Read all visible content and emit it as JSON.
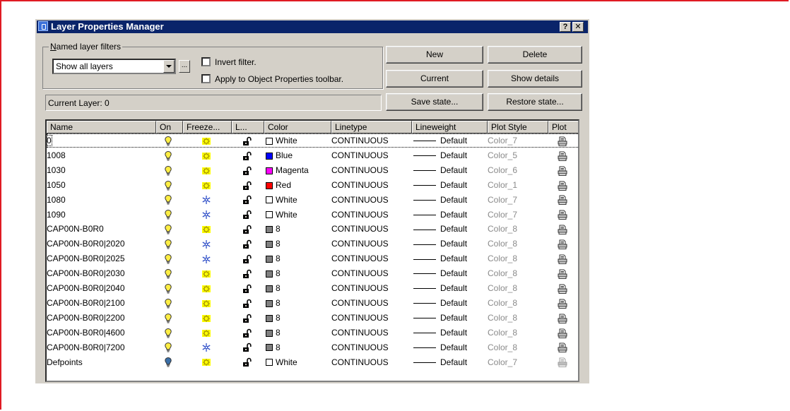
{
  "window": {
    "title": "Layer Properties Manager",
    "help_label": "?",
    "close_label": "✕"
  },
  "filters": {
    "group_label": "Named layer filters",
    "selected": "Show all layers",
    "ellipsis_label": "...",
    "invert_label": "Invert filter.",
    "invert_checked": false,
    "apply_label": "Apply to Object Properties toolbar.",
    "apply_checked": false
  },
  "buttons": {
    "new": "New",
    "delete": "Delete",
    "current": "Current",
    "show_details": "Show details",
    "save_state": "Save state...",
    "restore_state": "Restore state..."
  },
  "current_layer": "Current Layer:  0",
  "table": {
    "columns": [
      "Name",
      "On",
      "Freeze...",
      "L...",
      "Color",
      "Linetype",
      "Lineweight",
      "Plot Style",
      "Plot"
    ],
    "rows": [
      {
        "name": "0",
        "on": true,
        "freeze": "thawed",
        "locked": false,
        "color": "White",
        "color_hex": "#ffffff",
        "linetype": "CONTINUOUS",
        "lineweight": "Default",
        "plot_style": "Color_7",
        "plot": true
      },
      {
        "name": "1008",
        "on": true,
        "freeze": "thawed",
        "locked": false,
        "color": "Blue",
        "color_hex": "#0000ff",
        "linetype": "CONTINUOUS",
        "lineweight": "Default",
        "plot_style": "Color_5",
        "plot": true
      },
      {
        "name": "1030",
        "on": true,
        "freeze": "thawed",
        "locked": false,
        "color": "Magenta",
        "color_hex": "#ff00ff",
        "linetype": "CONTINUOUS",
        "lineweight": "Default",
        "plot_style": "Color_6",
        "plot": true
      },
      {
        "name": "1050",
        "on": true,
        "freeze": "thawed",
        "locked": false,
        "color": "Red",
        "color_hex": "#ff0000",
        "linetype": "CONTINUOUS",
        "lineweight": "Default",
        "plot_style": "Color_1",
        "plot": true
      },
      {
        "name": "1080",
        "on": true,
        "freeze": "frozen",
        "locked": false,
        "color": "White",
        "color_hex": "#ffffff",
        "linetype": "CONTINUOUS",
        "lineweight": "Default",
        "plot_style": "Color_7",
        "plot": true
      },
      {
        "name": "1090",
        "on": true,
        "freeze": "frozen",
        "locked": false,
        "color": "White",
        "color_hex": "#ffffff",
        "linetype": "CONTINUOUS",
        "lineweight": "Default",
        "plot_style": "Color_7",
        "plot": true
      },
      {
        "name": "CAP00N-B0R0",
        "on": true,
        "freeze": "thawed",
        "locked": false,
        "color": "8",
        "color_hex": "#808080",
        "linetype": "CONTINUOUS",
        "lineweight": "Default",
        "plot_style": "Color_8",
        "plot": true
      },
      {
        "name": "CAP00N-B0R0|2020",
        "on": true,
        "freeze": "frozen",
        "locked": false,
        "color": "8",
        "color_hex": "#808080",
        "linetype": "CONTINUOUS",
        "lineweight": "Default",
        "plot_style": "Color_8",
        "plot": true
      },
      {
        "name": "CAP00N-B0R0|2025",
        "on": true,
        "freeze": "frozen",
        "locked": false,
        "color": "8",
        "color_hex": "#808080",
        "linetype": "CONTINUOUS",
        "lineweight": "Default",
        "plot_style": "Color_8",
        "plot": true
      },
      {
        "name": "CAP00N-B0R0|2030",
        "on": true,
        "freeze": "thawed",
        "locked": false,
        "color": "8",
        "color_hex": "#808080",
        "linetype": "CONTINUOUS",
        "lineweight": "Default",
        "plot_style": "Color_8",
        "plot": true
      },
      {
        "name": "CAP00N-B0R0|2040",
        "on": true,
        "freeze": "thawed",
        "locked": false,
        "color": "8",
        "color_hex": "#808080",
        "linetype": "CONTINUOUS",
        "lineweight": "Default",
        "plot_style": "Color_8",
        "plot": true
      },
      {
        "name": "CAP00N-B0R0|2100",
        "on": true,
        "freeze": "thawed",
        "locked": false,
        "color": "8",
        "color_hex": "#808080",
        "linetype": "CONTINUOUS",
        "lineweight": "Default",
        "plot_style": "Color_8",
        "plot": true
      },
      {
        "name": "CAP00N-B0R0|2200",
        "on": true,
        "freeze": "thawed",
        "locked": false,
        "color": "8",
        "color_hex": "#808080",
        "linetype": "CONTINUOUS",
        "lineweight": "Default",
        "plot_style": "Color_8",
        "plot": true
      },
      {
        "name": "CAP00N-B0R0|4600",
        "on": true,
        "freeze": "thawed",
        "locked": false,
        "color": "8",
        "color_hex": "#808080",
        "linetype": "CONTINUOUS",
        "lineweight": "Default",
        "plot_style": "Color_8",
        "plot": true
      },
      {
        "name": "CAP00N-B0R0|7200",
        "on": true,
        "freeze": "frozen",
        "locked": false,
        "color": "8",
        "color_hex": "#808080",
        "linetype": "CONTINUOUS",
        "lineweight": "Default",
        "plot_style": "Color_8",
        "plot": true
      },
      {
        "name": "Defpoints",
        "on": true,
        "on_variant": "dark",
        "freeze": "thawed",
        "locked": false,
        "color": "White",
        "color_hex": "#ffffff",
        "linetype": "CONTINUOUS",
        "lineweight": "Default",
        "plot_style": "Color_7",
        "plot": false
      }
    ]
  },
  "colors": {
    "titlebar": "#0a246a",
    "window_bg": "#d4d0c8",
    "frame_border": "#e01b24",
    "bulb_on": "#ffee44",
    "sun_yellow": "#ffff00",
    "snowflake": "#3050c8"
  },
  "icons": {
    "on": "lightbulb-icon",
    "thawed": "sun-icon",
    "frozen": "snowflake-icon",
    "unlocked": "padlock-open-icon",
    "plot": "printer-icon"
  }
}
